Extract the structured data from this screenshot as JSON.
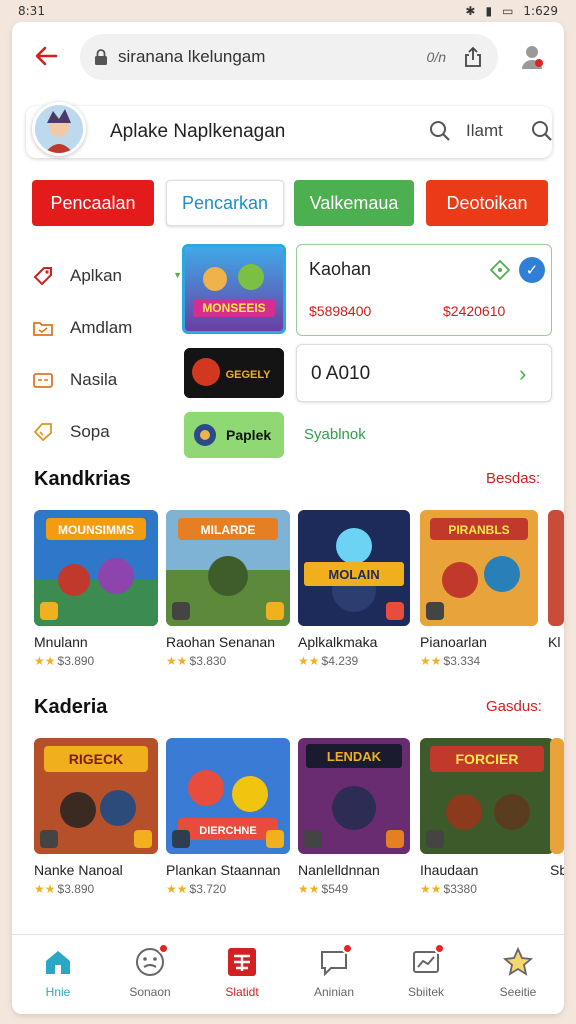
{
  "statusbar": {
    "time": "8:31",
    "battery": "1:629"
  },
  "topbar": {
    "url": "siranana lkelungam",
    "url_extra": "0/n"
  },
  "search": {
    "title": "Aplake Naplkenagan",
    "query": "Ilamt"
  },
  "chips": [
    "Pencaalan",
    "Pencarkan",
    "Valkemaua",
    "Deotoikan"
  ],
  "sidebar": {
    "items": [
      {
        "label": "Aplkan",
        "icon": "tag-icon"
      },
      {
        "label": "Amdlam",
        "icon": "folder-icon"
      },
      {
        "label": "Nasila",
        "icon": "card-icon"
      },
      {
        "label": "Sopa",
        "icon": "label-icon"
      }
    ]
  },
  "featured": {
    "thumb1_text": "MONSEEIS",
    "thumb2_text": "GEGELY",
    "thumb3_label": "Paplek"
  },
  "offer": {
    "title": "Kaohan",
    "price1": "$5898400",
    "price2": "$2420610"
  },
  "code": {
    "text": "0 A010"
  },
  "sublink": "Syablnok",
  "section1": {
    "title": "Kandkrias",
    "link": "Besdas:",
    "games": [
      {
        "name": "Mnulann",
        "rating": "$3.890",
        "stars": "★★",
        "art": "MOUNSIMMS"
      },
      {
        "name": "Raohan Senanan",
        "rating": "$3.830",
        "stars": "★★",
        "art": "MILARDE"
      },
      {
        "name": "Aplkalkmaka",
        "rating": "$4.239",
        "stars": "★★",
        "art": "MOLAIN"
      },
      {
        "name": "Pianoarlan",
        "rating": "$3.334",
        "stars": "★★",
        "art": "PIRANBLS"
      },
      {
        "name": "Kl",
        "rating": "",
        "stars": "",
        "art": ""
      }
    ]
  },
  "section2": {
    "title": "Kaderia",
    "link": "Gasdus:",
    "games": [
      {
        "name": "Nanke Nanoal",
        "rating": "$3.890",
        "stars": "★★",
        "art": "RIGECK"
      },
      {
        "name": "Plankan Staannan",
        "rating": "$3.720",
        "stars": "★★",
        "art": "DIERCHNE"
      },
      {
        "name": "Nanlelldnnan",
        "rating": "$549",
        "stars": "★★",
        "art": "LENDAK"
      },
      {
        "name": "Ihaudaan",
        "rating": "$3380",
        "stars": "★★",
        "art": "FORCIER"
      },
      {
        "name": "Sb",
        "rating": "",
        "stars": "",
        "art": ""
      }
    ]
  },
  "bottomnav": {
    "tabs": [
      {
        "label": "Hnie",
        "icon": "home-icon"
      },
      {
        "label": "Sonaon",
        "icon": "face-icon"
      },
      {
        "label": "Slatidt",
        "icon": "store-icon"
      },
      {
        "label": "Aninian",
        "icon": "message-icon"
      },
      {
        "label": "Sbiitek",
        "icon": "chart-icon"
      },
      {
        "label": "Seeitie",
        "icon": "star-icon"
      }
    ]
  },
  "colors": {
    "accent_red": "#e41b1b",
    "accent_green": "#4caf50",
    "accent_blue": "#2aa9e0"
  }
}
